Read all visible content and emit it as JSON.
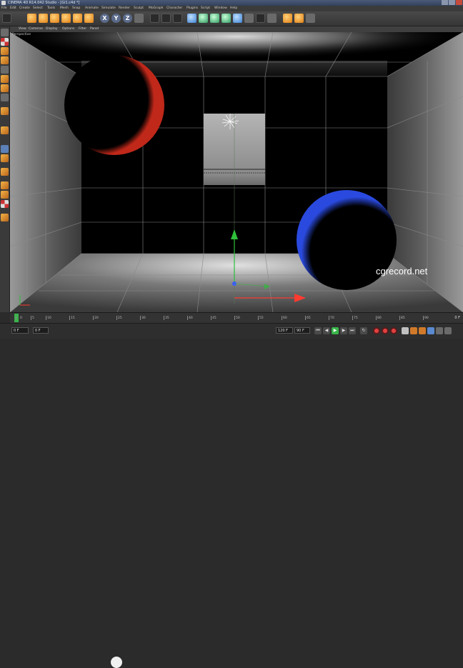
{
  "window": {
    "title": "CINEMA 4D R14.042 Studio - [Gi1.c4d *]"
  },
  "menu": {
    "items": [
      "File",
      "Edit",
      "Create",
      "Select",
      "Tools",
      "Mesh",
      "Snap",
      "Animate",
      "Simulate",
      "Render",
      "Sculpt",
      "MoGraph",
      "Character",
      "Plugins",
      "Script",
      "Window",
      "Help"
    ]
  },
  "toolbar": {
    "axis_x": "X",
    "axis_y": "Y",
    "axis_z": "Z"
  },
  "viewport": {
    "menu": [
      "View",
      "Cameras",
      "Display",
      "Options",
      "Filter",
      "Panel"
    ],
    "camera_label": "Perspective"
  },
  "timeline": {
    "ticks": [
      "0",
      "5",
      "10",
      "15",
      "20",
      "25",
      "30",
      "35",
      "40",
      "45",
      "50",
      "55",
      "60",
      "65",
      "70",
      "75",
      "80",
      "85",
      "90"
    ],
    "end_frame": "0 F"
  },
  "transport": {
    "current_frame": "0 F",
    "start_frame": "0 F",
    "end_frame": "120 F",
    "max_frame": "90 F"
  },
  "watermark": "cgrecord.net",
  "colors": {
    "play": "#39b44a",
    "record": "#e04040",
    "axis_x": "#ff3b30",
    "axis_y": "#2fbf3a",
    "axis_z": "#3b5bff"
  }
}
